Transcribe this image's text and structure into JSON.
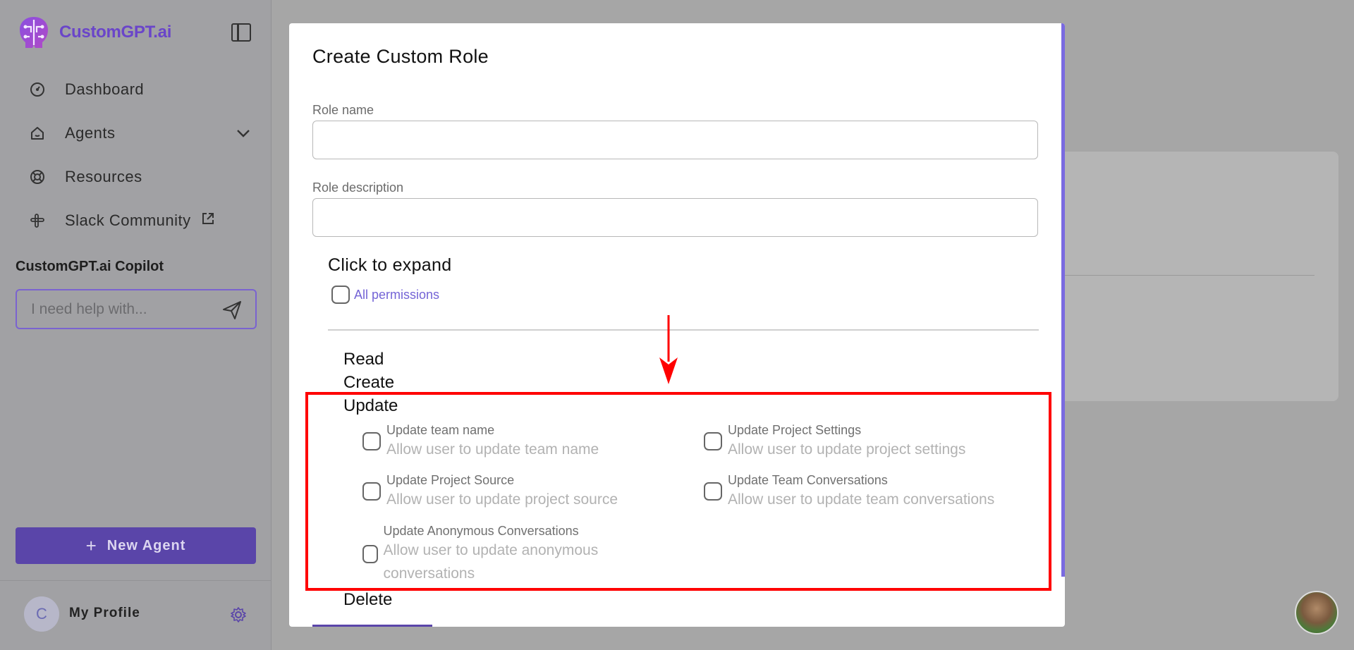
{
  "app": {
    "brand_name": "CustomGPT.ai",
    "brand_color": "#6a45c9"
  },
  "sidebar": {
    "collapse_icon": "sidebar-toggle-icon",
    "items": [
      {
        "label": "Dashboard",
        "icon": "dashboard-gauge-icon"
      },
      {
        "label": "Agents",
        "icon": "home-icon",
        "has_dropdown": true
      },
      {
        "label": "Resources",
        "icon": "lifebuoy-icon"
      },
      {
        "label": "Slack Community",
        "icon": "slack-icon",
        "external": true
      }
    ],
    "copilot": {
      "title": "CustomGPT.ai Copilot",
      "placeholder": "I need help with...",
      "send_icon": "send-icon"
    },
    "new_agent_label": "New Agent",
    "profile": {
      "avatar_letter": "C",
      "name": "My Profile",
      "settings_icon": "gear-icon"
    }
  },
  "modal": {
    "title": "Create Custom Role",
    "role_name_label": "Role name",
    "role_name_value": "",
    "role_description_label": "Role description",
    "role_description_value": "",
    "expand_title": "Click to expand",
    "all_permissions_label": "All permissions",
    "all_permissions_checked": false,
    "sections": {
      "read": "Read",
      "create": "Create",
      "update": "Update",
      "delete": "Delete"
    },
    "update_permissions": [
      {
        "title": "Update team name",
        "description": "Allow user to update team name",
        "checked": false
      },
      {
        "title": "Update Project Settings",
        "description": "Allow user to update project settings",
        "checked": false
      },
      {
        "title": "Update Project Source",
        "description": "Allow user to update project source",
        "checked": false
      },
      {
        "title": "Update Team Conversations",
        "description": "Allow user to update team conversations",
        "checked": false
      },
      {
        "title": "Update Anonymous Conversations",
        "description": "Allow user to update anonymous conversations",
        "checked": false
      }
    ]
  },
  "annotation": {
    "box_color": "#ff0000",
    "arrow_color": "#ff0000"
  }
}
